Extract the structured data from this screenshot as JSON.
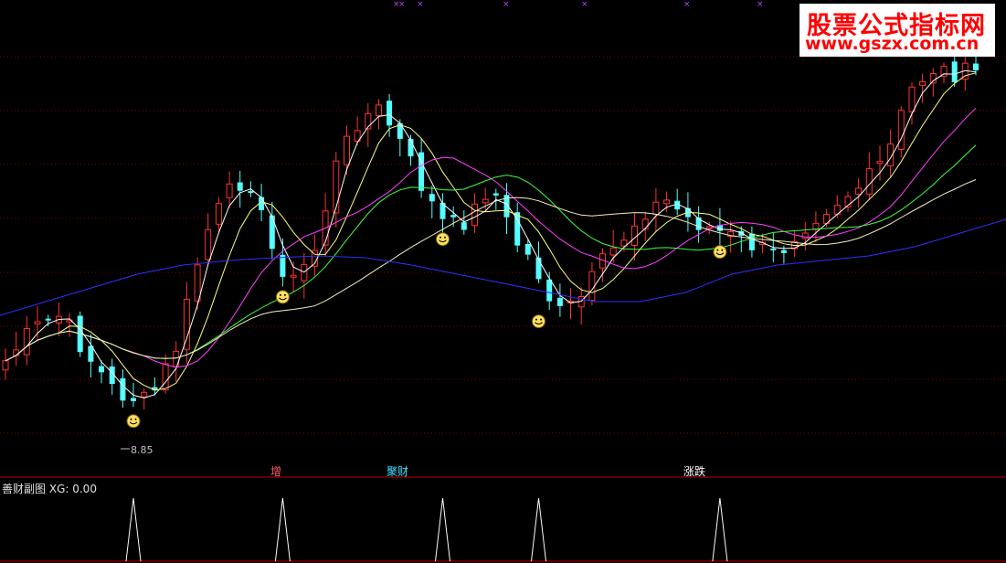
{
  "watermark": {
    "line1": "股票公式指标网",
    "line2": "www.gszx.com.cn"
  },
  "main_panel": {
    "low_annotation": "8.85"
  },
  "signal_markers": [
    {
      "label": "增",
      "color": "#ff6060"
    },
    {
      "label": "聚财",
      "color": "#40e0ff"
    },
    {
      "label": "涨跌",
      "color": "#ffffff"
    }
  ],
  "sub_panel": {
    "title": "善财副图",
    "indicator": "XG:",
    "value": "0.00"
  },
  "colors": {
    "up": "#ff3232",
    "down": "#54ffff",
    "ma5": "#ffffff",
    "ma10": "#ffff80",
    "ma20": "#ff40ff",
    "ma30": "#40ff40",
    "ma60": "#f0f0c0",
    "ma120": "#3030ff",
    "grid": "#800000",
    "smile": "#ffe060"
  },
  "chart_data": {
    "type": "candlestick",
    "low_value": 8.85,
    "candle_count": 92,
    "signal_points": [
      12,
      26,
      41,
      50,
      67
    ],
    "xg_values_at_signals": [
      1,
      1,
      1,
      1,
      1
    ]
  }
}
